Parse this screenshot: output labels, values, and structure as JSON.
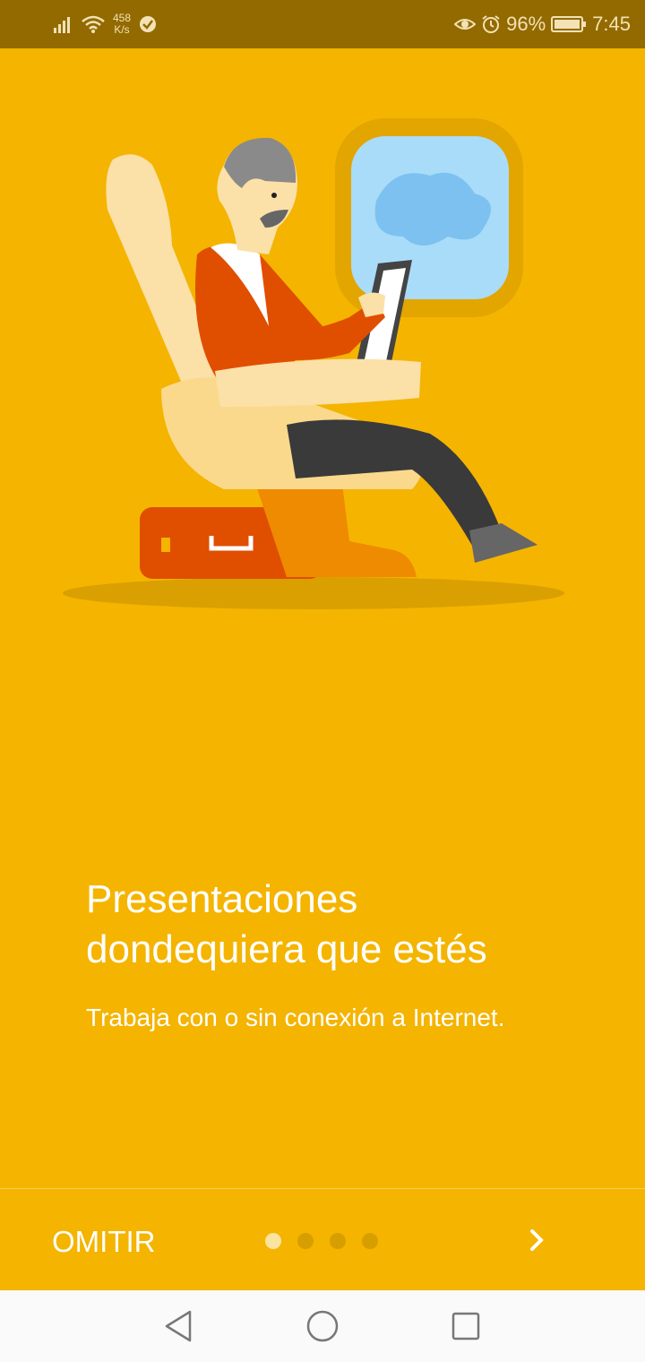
{
  "status_bar": {
    "net_speed_value": "458",
    "net_speed_unit": "K/s",
    "battery": "96%",
    "time": "7:45",
    "icons": [
      "signal-icon",
      "wifi-icon",
      "check-circle-icon",
      "eye-icon",
      "alarm-icon",
      "battery-icon"
    ]
  },
  "onboarding": {
    "title_line1": "Presentaciones",
    "title_line2": "dondequiera que estés",
    "subtitle": "Trabaja con o sin conexión a Internet.",
    "skip_label": "OMITIR",
    "page_count": 4,
    "current_page": 1
  },
  "colors": {
    "background": "#f4b400",
    "status_bar": "#936a00",
    "text": "#ffffff",
    "accent_orange": "#e05000"
  },
  "nav_bar": {
    "icons": [
      "back-icon",
      "home-icon",
      "recents-icon"
    ]
  }
}
